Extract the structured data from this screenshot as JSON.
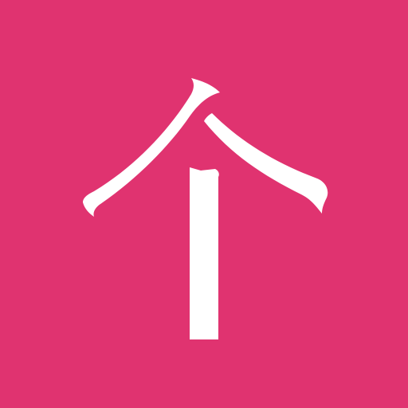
{
  "app_icon": {
    "glyph": "个",
    "background_color": "#e03370",
    "glyph_color": "#ffffff"
  }
}
